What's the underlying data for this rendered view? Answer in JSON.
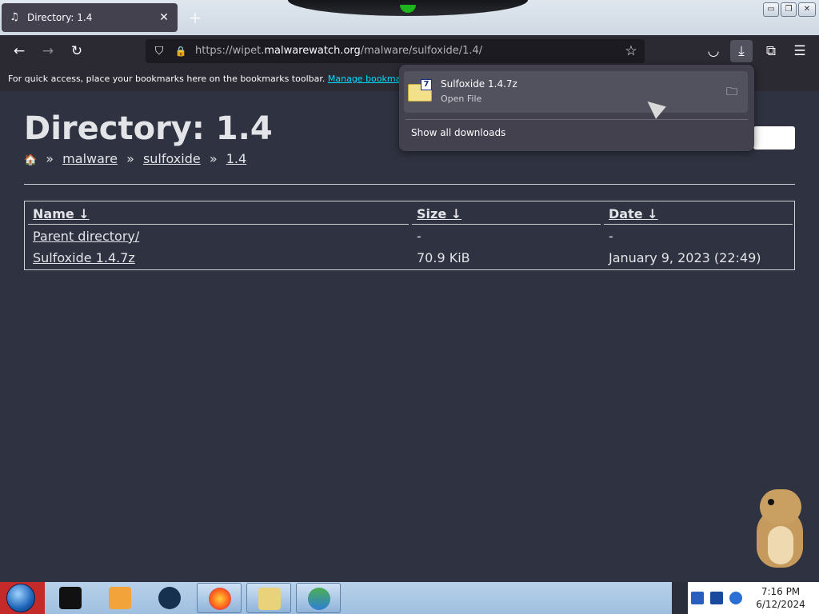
{
  "tab": {
    "title": "Directory: 1.4",
    "icon": "music-note-icon",
    "close": "✕",
    "new_tab": "+"
  },
  "window_controls": {
    "minimize": "▭",
    "restore": "❐",
    "close": "✕"
  },
  "navbar": {
    "back": "←",
    "forward": "→",
    "reload": "↻",
    "url_prefix": "https://wipet.",
    "url_host": "malwarewatch.org",
    "url_suffix": "/malware/sulfoxide/1.4/",
    "shield": "⛉",
    "lock": "🔒",
    "star": "☆",
    "pocket": "◡",
    "download": "⤓",
    "extensions": "⧉",
    "menu": "☰"
  },
  "bookmarks": {
    "message": "For quick access, place your bookmarks here on the bookmarks toolbar.",
    "link": "Manage bookmarks..."
  },
  "page": {
    "title": "Directory: 1.4",
    "breadcrumb": {
      "home": "🏠",
      "sep": "»",
      "items": [
        "malware",
        "sulfoxide",
        "1.4"
      ]
    },
    "table": {
      "headers": {
        "name": "Name ↓",
        "size": "Size ↓",
        "date": "Date ↓"
      },
      "rows": [
        {
          "name": "Parent directory/",
          "size": "-",
          "date": "-"
        },
        {
          "name": "Sulfoxide 1.4.7z",
          "size": "70.9 KiB",
          "date": "January 9, 2023 (22:49)"
        }
      ]
    }
  },
  "downloads_panel": {
    "file_name": "Sulfoxide 1.4.7z",
    "status": "Open File",
    "file_badge": "7",
    "folder_icon": "🗀",
    "show_all": "Show all downloads"
  },
  "taskbar": {
    "time": "7:16 PM",
    "date": "6/12/2024",
    "colors": {
      "accent_red": "#c42a2a",
      "taskbar": "#b8d1ea"
    }
  }
}
